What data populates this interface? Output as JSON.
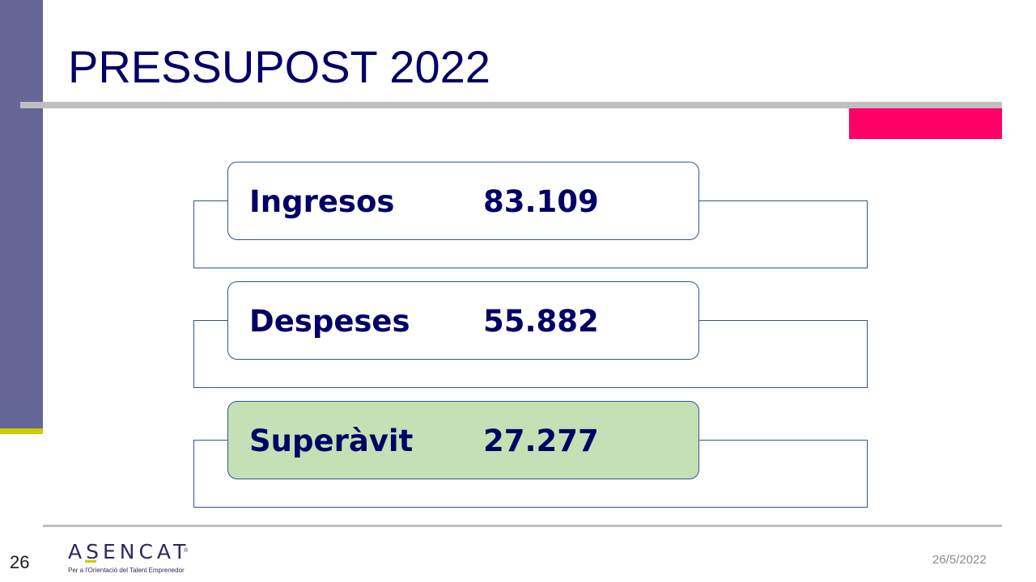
{
  "slide": {
    "title": "PRESSUPOST 2022",
    "page_number": "26",
    "date": "26/5/2022"
  },
  "budget": {
    "rows": [
      {
        "label": "Ingresos",
        "value": "83.109"
      },
      {
        "label": "Despeses",
        "value": "55.882"
      },
      {
        "label": "Superàvit",
        "value": "27.277"
      }
    ]
  },
  "logo": {
    "wordmark": "ASENCAT",
    "registered": "®",
    "tagline": "Per a l'Orientació del Talent Emprenedor"
  },
  "colors": {
    "title": "#000066",
    "sidebar": "#666699",
    "sidebar_accent": "#cccc00",
    "accent_block": "#ff0066",
    "rule": "#bfbfbf",
    "card_border": "#2f5597",
    "highlight_card": "#c5e0b4"
  }
}
